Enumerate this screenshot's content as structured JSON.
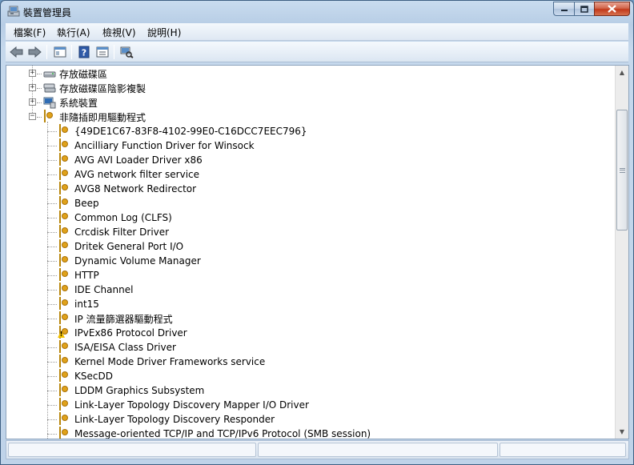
{
  "window": {
    "title": "裝置管理員",
    "icon": "device-manager-icon"
  },
  "caption_buttons": [
    {
      "name": "minimize-button",
      "icon": "minimize-icon"
    },
    {
      "name": "maximize-button",
      "icon": "maximize-icon"
    },
    {
      "name": "close-button",
      "icon": "close-icon"
    }
  ],
  "menu": [
    {
      "label": "檔案(F)"
    },
    {
      "label": "執行(A)"
    },
    {
      "label": "檢視(V)"
    },
    {
      "label": "說明(H)"
    }
  ],
  "toolbar": [
    {
      "name": "back-button",
      "icon": "back-arrow-icon"
    },
    {
      "name": "forward-button",
      "icon": "forward-arrow-icon"
    },
    {
      "name": "show-hide-console-tree-button",
      "icon": "console-tree-icon"
    },
    {
      "name": "help-button",
      "icon": "help-icon"
    },
    {
      "name": "properties-button",
      "icon": "properties-icon"
    },
    {
      "name": "scan-hardware-button",
      "icon": "scan-hardware-icon"
    }
  ],
  "tree": {
    "categories": [
      {
        "label": "存放磁碟區",
        "expanded": false,
        "icon": "storage-volume-icon"
      },
      {
        "label": "存放磁碟區陰影複製",
        "expanded": false,
        "icon": "shadow-copy-icon"
      },
      {
        "label": "系統裝置",
        "expanded": false,
        "icon": "system-device-icon"
      },
      {
        "label": "非隨插即用驅動程式",
        "expanded": true,
        "icon": "driver-icon"
      }
    ],
    "drivers": [
      {
        "label": "{49DE1C67-83F8-4102-99E0-C16DCC7EEC796}"
      },
      {
        "label": "Ancilliary Function Driver for Winsock"
      },
      {
        "label": "AVG AVI Loader Driver x86"
      },
      {
        "label": "AVG network filter service"
      },
      {
        "label": "AVG8 Network Redirector"
      },
      {
        "label": "Beep"
      },
      {
        "label": "Common Log (CLFS)"
      },
      {
        "label": "Crcdisk Filter Driver"
      },
      {
        "label": "Dritek General Port I/O"
      },
      {
        "label": "Dynamic Volume Manager"
      },
      {
        "label": "HTTP"
      },
      {
        "label": "IDE Channel"
      },
      {
        "label": "int15"
      },
      {
        "label": "IP 流量篩選器驅動程式"
      },
      {
        "label": "IPvEx86 Protocol Driver",
        "warning": true
      },
      {
        "label": "ISA/EISA Class Driver"
      },
      {
        "label": "Kernel Mode Driver Frameworks service"
      },
      {
        "label": "KSecDD"
      },
      {
        "label": "LDDM Graphics Subsystem"
      },
      {
        "label": "Link-Layer Topology Discovery Mapper I/O Driver"
      },
      {
        "label": "Link-Layer Topology Discovery Responder"
      },
      {
        "label": "Message-oriented TCP/IP and TCP/IPv6 Protocol (SMB session)"
      }
    ]
  },
  "colors": {
    "accent": "#3e5f82",
    "driver_icon": "#e0a21a",
    "close_button": "#c2391b"
  }
}
